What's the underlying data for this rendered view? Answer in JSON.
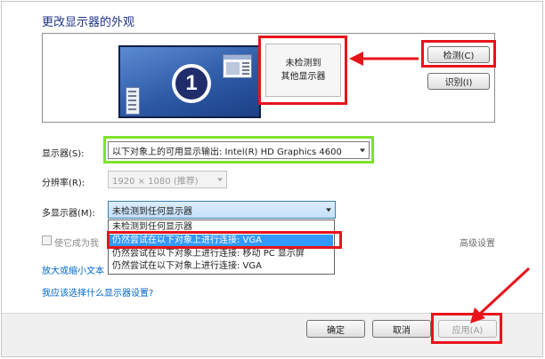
{
  "dialog": {
    "heading": "更改显示器的外观",
    "buttons": {
      "detect": "检测(C)",
      "identify": "识别(I)",
      "ok": "确定",
      "cancel": "取消",
      "apply": "应用(A)"
    }
  },
  "preview": {
    "monitor_number": "1",
    "not_detected_line1": "未检测到",
    "not_detected_line2": "其他显示器"
  },
  "settings": {
    "display_label": "显示器(S):",
    "display_value": "以下对象上的可用显示输出: Intel(R) HD Graphics 4600",
    "resolution_label": "分辨率(R):",
    "resolution_value": "1920 × 1080 (推荐)",
    "multi_label": "多显示器(M):",
    "multi_value": "未检测到任何显示器",
    "multi_options": [
      "未检测到任何显示器",
      "仍然尝试在以下对象上进行连接: VGA",
      "仍然尝试在以下对象上进行连接: 移动 PC 显示屏",
      "仍然尝试在以下对象上进行连接: VGA"
    ],
    "main_display_checkbox": "使它成为我",
    "advanced_link": "高级设置",
    "resize_link": "放大或缩小文本",
    "which_link": "我应该选择什么显示器设置?"
  },
  "colors": {
    "highlight": "#e8131b",
    "green_highlight": "#7fe12c",
    "link": "#0066cc",
    "selection": "#3399ff"
  }
}
